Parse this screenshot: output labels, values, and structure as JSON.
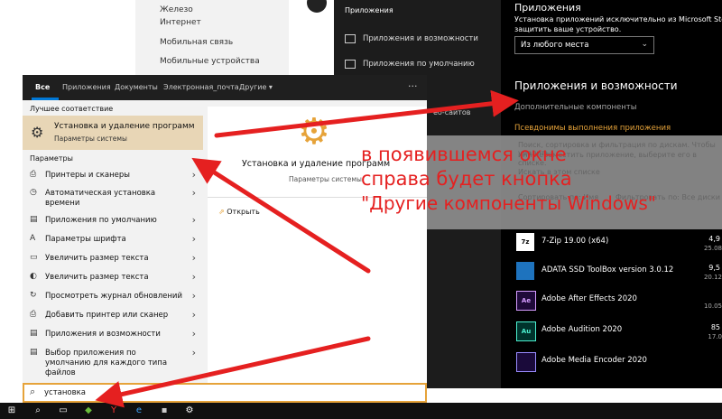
{
  "bg_settings": {
    "items": [
      "Железо",
      "Интернет",
      "Мобильная связь",
      "Мобильные устройства"
    ],
    "page_fragment": [
      "К",
      "г",
      "Е"
    ]
  },
  "apps_window": {
    "nav_header": "Приложения",
    "nav_items": [
      "Приложения и возможности",
      "Приложения по умолчанию"
    ],
    "nav_fragment": "еб-сайтов",
    "top_title": "Приложения",
    "install_text_1": "Установка приложений исключительно из Microsoft Store пом",
    "install_text_2": "защитить ваше устройство.",
    "dropdown_value": "Из любого места",
    "section_title": "Приложения и возможности",
    "link_components": "Дополнительные компоненты",
    "link_aliases": "Псевдонимы выполнения приложения",
    "dim_text_1": "Поиск, сортировка и фильтрация по дискам. Чтобы удалить",
    "dim_text_2": "или переместить приложение, выберите его в списке.",
    "dim_search": "Искать в этом списке",
    "dim_sort": "Сортировать по: Имя",
    "dim_filter": "Фильтровать по: Все диски",
    "apps": [
      {
        "name": "7-Zip 19.00 (x64)",
        "size": "4,9",
        "date": "25.08",
        "icon_label": "7z",
        "color": "#ffffff"
      },
      {
        "name": "ADATA SSD ToolBox version 3.0.12",
        "size": "9,5",
        "date": "20.12",
        "icon_label": "",
        "color": "#1e73be"
      },
      {
        "name": "Adobe After Effects 2020",
        "size": "",
        "date": "10.05",
        "icon_label": "Ae",
        "color": "#1f0a3a"
      },
      {
        "name": "Adobe Audition 2020",
        "size": "85",
        "date": "17.0",
        "icon_label": "Au",
        "color": "#00332c"
      },
      {
        "name": "Adobe Media Encoder 2020",
        "size": "",
        "date": "",
        "icon_label": "",
        "color": "#1a0a3a"
      }
    ]
  },
  "start_menu": {
    "tabs": [
      "Все",
      "Приложения",
      "Документы",
      "Электронная_почта",
      "Другие ▾"
    ],
    "dots": "···",
    "best_match_label": "Лучшее соответствие",
    "best_match_title": "Установка и удаление программ",
    "best_match_sub": "Параметры системы",
    "params_label": "Параметры",
    "rows": [
      "Принтеры и сканеры",
      "Автоматическая установка времени",
      "Приложения по умолчанию",
      "Параметры шрифта",
      "Увеличить размер текста",
      "Увеличить размер текста",
      "Просмотреть журнал обновлений",
      "Добавить принтер или сканер",
      "Приложения и возможности",
      "Выбор приложения по умолчанию для каждого типа файлов"
    ],
    "right_title": "Установка и удаление программ",
    "right_sub": "Параметры системы",
    "right_open": "Открыть"
  },
  "search": {
    "value": "установка"
  },
  "annotation": {
    "line1": "в появившемся окне",
    "line2": "справа будет кнопка",
    "line3": "\"Другие компоненты Windows\"",
    "color": "#e52020"
  },
  "colors": {
    "accent": "#e6a33a",
    "highlight": "#e8d6b6",
    "start_blue": "#0078d7"
  }
}
